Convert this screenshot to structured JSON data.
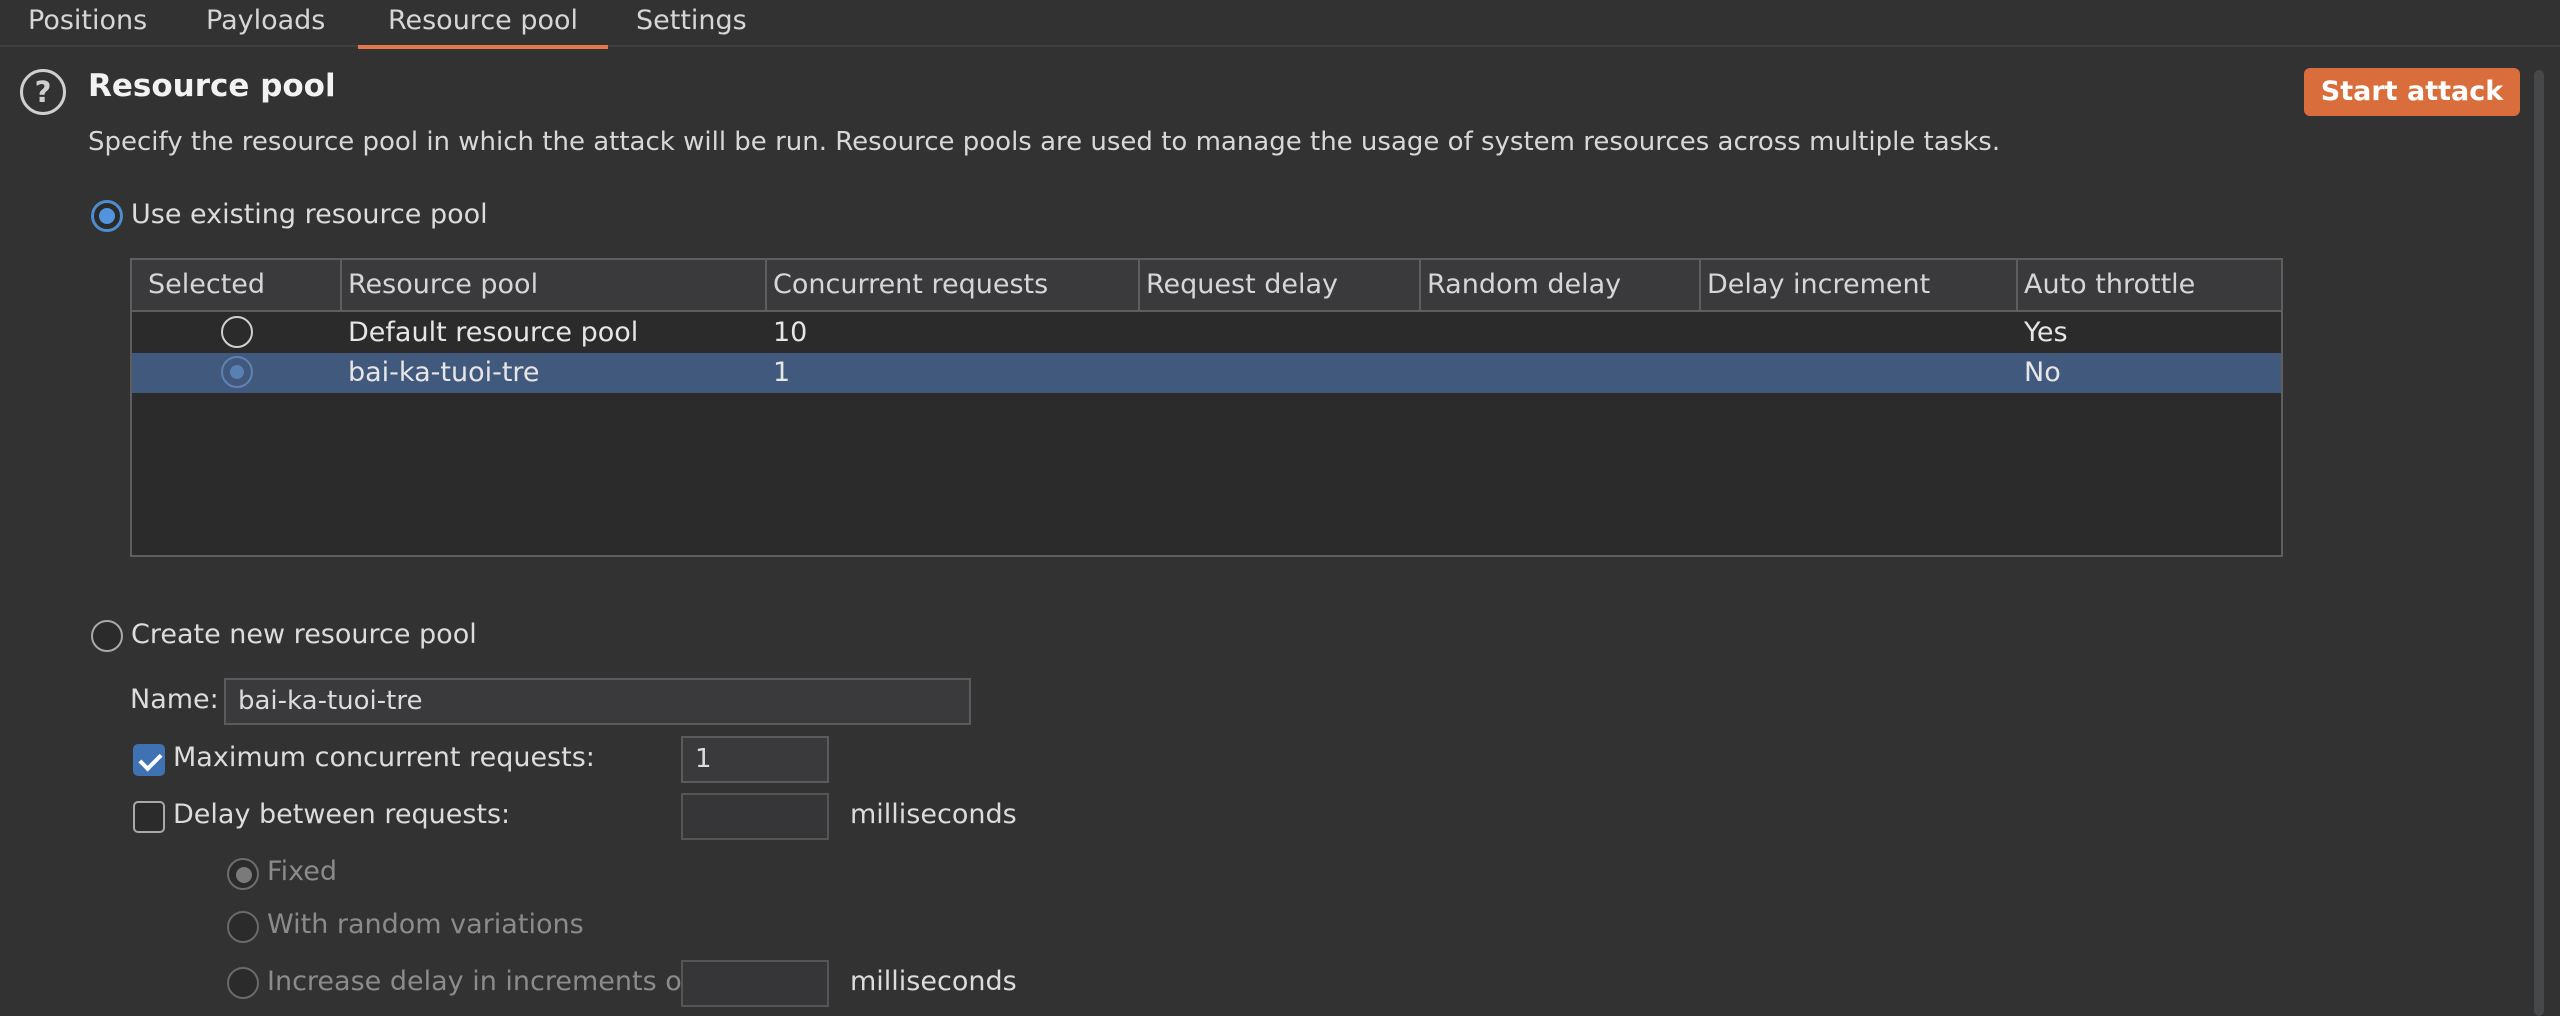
{
  "tabs": [
    {
      "label": "Positions",
      "active": false
    },
    {
      "label": "Payloads",
      "active": false
    },
    {
      "label": "Resource pool",
      "active": true
    },
    {
      "label": "Settings",
      "active": false
    }
  ],
  "section": {
    "title": "Resource pool",
    "description": "Specify the resource pool in which the attack will be run. Resource pools are used to manage the usage of system resources across multiple tasks.",
    "help_icon_glyph": "?"
  },
  "start_attack_label": "Start attack",
  "existing_pool": {
    "label": "Use existing resource pool",
    "selected": true
  },
  "table": {
    "columns": [
      "Selected",
      "Resource pool",
      "Concurrent requests",
      "Request delay",
      "Random delay",
      "Delay increment",
      "Auto throttle"
    ],
    "rows": [
      {
        "selected": false,
        "pool": "Default resource pool",
        "concurrent": "10",
        "request_delay": "",
        "random_delay": "",
        "delay_increment": "",
        "auto_throttle": "Yes"
      },
      {
        "selected": true,
        "pool": "bai-ka-tuoi-tre",
        "concurrent": "1",
        "request_delay": "",
        "random_delay": "",
        "delay_increment": "",
        "auto_throttle": "No"
      }
    ]
  },
  "new_pool": {
    "label": "Create new resource pool",
    "selected": false,
    "name_label": "Name:",
    "name_value": "bai-ka-tuoi-tre",
    "max_concurrent_label": "Maximum concurrent requests:",
    "max_concurrent_checked": true,
    "max_concurrent_value": "1",
    "delay_label": "Delay between requests:",
    "delay_checked": false,
    "delay_value": "",
    "delay_unit": "milliseconds",
    "fixed_label": "Fixed",
    "random_label": "With random variations",
    "increase_label": "Increase delay in increments of",
    "increase_value": "",
    "increase_unit": "milliseconds"
  },
  "colors": {
    "accent_orange": "#d96d3b",
    "selection_blue": "#41597c",
    "background": "#323233"
  }
}
